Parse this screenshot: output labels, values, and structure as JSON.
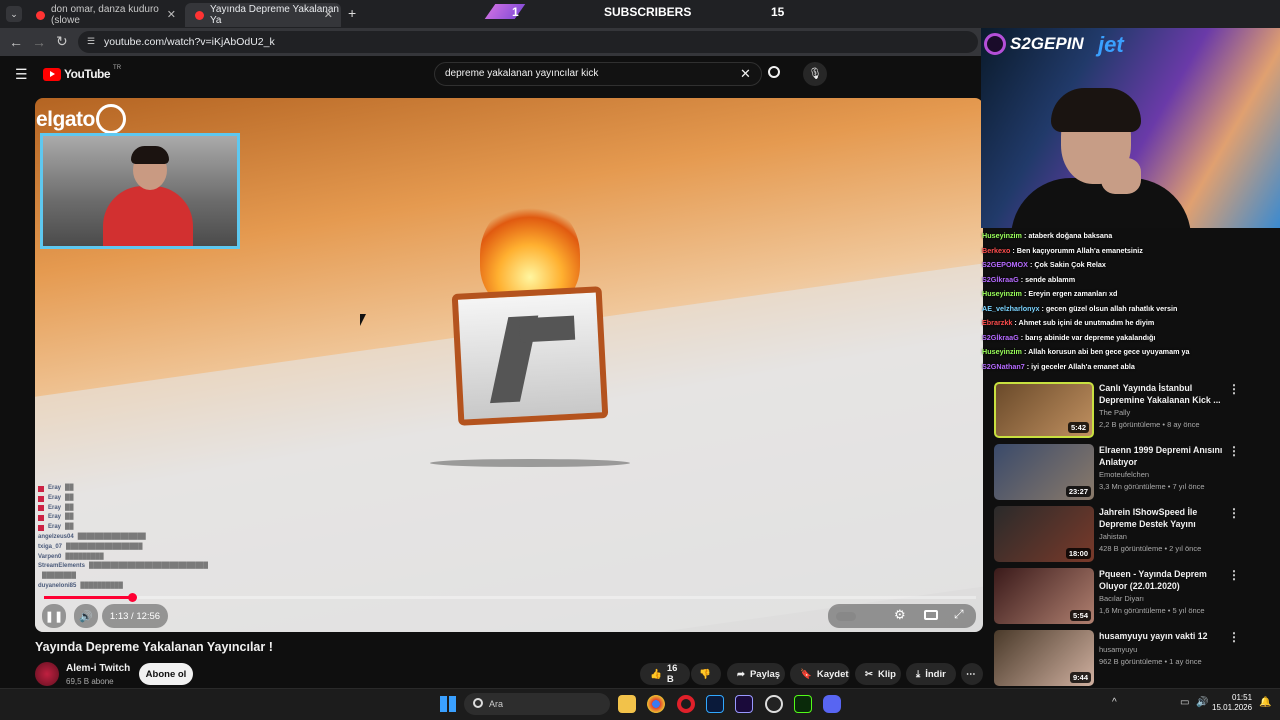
{
  "browser": {
    "tabs": [
      {
        "label": "don omar, danza kuduro (slowe"
      },
      {
        "label": "Yayında Depreme Yakalanan Ya"
      }
    ],
    "new_tab_label": "+",
    "url": "youtube.com/watch?v=iKjAbOdU2_k"
  },
  "overlay": {
    "left_count": "1",
    "subscribers_label": "SUBSCRIBERS",
    "right_count": "15",
    "brand": "S2GEPIN",
    "sponsor": "jet"
  },
  "youtube": {
    "logo_text": "YouTube",
    "region": "TR",
    "search_value": "depreme yakalanan yayıncılar kick"
  },
  "video": {
    "elgato_text": "elgato",
    "chat": [
      {
        "name": "Eray",
        "msg": "██"
      },
      {
        "name": "Eray",
        "msg": "██"
      },
      {
        "name": "Eray",
        "msg": "██"
      },
      {
        "name": "Eray",
        "msg": "██"
      },
      {
        "name": "Eray",
        "msg": "██"
      },
      {
        "name": "angelzeus04",
        "msg": "████████████████"
      },
      {
        "name": "txiga_07",
        "msg": "██████████████████"
      },
      {
        "name": "Varpen0",
        "msg": "█████████"
      },
      {
        "name": "StreamElements",
        "msg": "████████████████████████████"
      },
      {
        "name": "",
        "msg": "████████"
      },
      {
        "name": "duyaneloni85",
        "msg": "██████████"
      }
    ],
    "time_current": "1:13",
    "time_total": "12:56",
    "progress_fraction": 0.094
  },
  "meta": {
    "title": "Yayında Depreme Yakalanan Yayıncılar !",
    "channel": "Alem-i Twitch",
    "subscribers": "69,5 B abone",
    "subscribe_label": "Abone ol",
    "likes": "16 B",
    "share_label": "Paylaş",
    "save_label": "Kaydet",
    "clip_label": "Klip",
    "download_label": "İndir"
  },
  "stream_chat": [
    {
      "user": "Huseyinzim",
      "color": "#9aff5a",
      "msg": "ataberk doğana baksana"
    },
    {
      "user": "Berkexo",
      "color": "#ff4d4d",
      "msg": "Ben kaçıyorumm Allah'a emanetsiniz"
    },
    {
      "user": "S2GEPOMOX",
      "color": "#b56aff",
      "msg": "Çok Sakin Çok Relax"
    },
    {
      "user": "S2GİkraaG",
      "color": "#b56aff",
      "msg": "sende ablamm"
    },
    {
      "user": "Huseyinzim",
      "color": "#9aff5a",
      "msg": "Ereyin ergen zamanları xd"
    },
    {
      "user": "AE_velzharlonyx",
      "color": "#7bd4ff",
      "msg": "gecen güzel olsun allah rahatlık versin"
    },
    {
      "user": "Ebrarzkk",
      "color": "#ff4d4d",
      "msg": "Ahmet sub içini de unutmadım he diyim"
    },
    {
      "user": "S2GİkraaG",
      "color": "#b56aff",
      "msg": "barış abinide var depreme yakalandığı"
    },
    {
      "user": "Huseyinzim",
      "color": "#9aff5a",
      "msg": "Allah korusun abi ben gece gece uyuyamam ya"
    },
    {
      "user": "S2GNathan7",
      "color": "#b56aff",
      "msg": "iyi geceler Allah'a emanet abla"
    }
  ],
  "recommendations": [
    {
      "title": "Canlı Yayında İstanbul Depremine Yakalanan Kick ...",
      "channel": "The Pally",
      "meta": "2,2 B görüntüleme • 8 ay önce",
      "duration": "5:42",
      "thumb_color": "#6a4a2a"
    },
    {
      "title": "Elraenn 1999 Depremi Anısını Anlatıyor",
      "channel": "Emoteufelchen",
      "meta": "3,3 Mn görüntüleme • 7 yıl önce",
      "duration": "23:27",
      "thumb_color": "#3a4a6a"
    },
    {
      "title": "Jahrein IShowSpeed İle Depreme Destek Yayını",
      "channel": "Jahistan",
      "meta": "428 B görüntüleme • 2 yıl önce",
      "duration": "18:00",
      "thumb_color": "#7a3a2a"
    },
    {
      "title": "Pqueen - Yayında Deprem Oluyor (22.01.2020)",
      "channel": "Bacılar Diyarı",
      "meta": "1,6 Mn görüntüleme • 5 yıl önce",
      "duration": "5:54",
      "thumb_color": "#5a2a2a"
    },
    {
      "title": "husamyuyu yayın vakti 12",
      "channel": "husamyuyu",
      "meta": "962 B görüntüleme • 1 ay önce",
      "duration": "9:44",
      "thumb_color": "#4a3a2a"
    }
  ],
  "taskbar": {
    "search_placeholder": "Ara",
    "time": "01:51",
    "date": "15.01.2026"
  }
}
